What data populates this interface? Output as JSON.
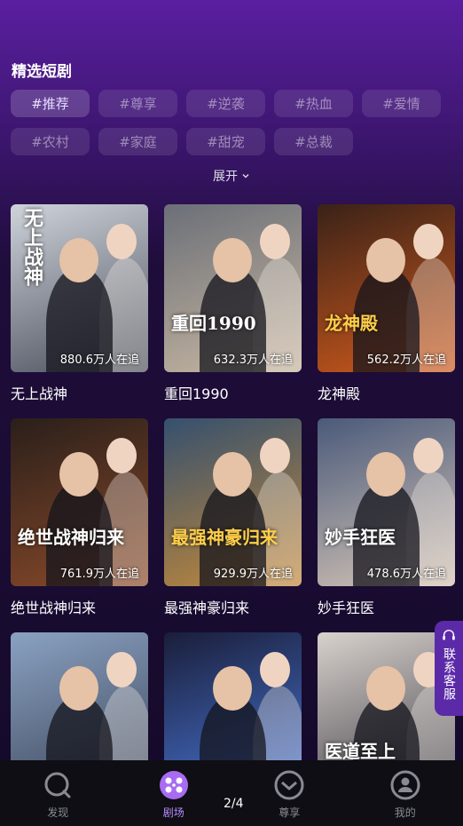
{
  "section": {
    "title": "精选短剧"
  },
  "tags": [
    "#推荐",
    "#尊享",
    "#逆袭",
    "#热血",
    "#爱情",
    "#农村",
    "#家庭",
    "#甜宠",
    "#总裁"
  ],
  "active_tag_index": 0,
  "expand_label": "展开",
  "dramas": [
    {
      "title": "无上战神",
      "watchers": "880.6万人在追",
      "poster_text": "无上战神",
      "colors": [
        "#cfd3da",
        "#4a4f5c"
      ]
    },
    {
      "title": "重回1990",
      "watchers": "632.3万人在追",
      "poster_text": "重回1990",
      "colors": [
        "#6b6f78",
        "#c9b8a2"
      ]
    },
    {
      "title": "龙神殿",
      "watchers": "562.2万人在追",
      "poster_text": "龙神殿",
      "colors": [
        "#3a2218",
        "#d05a1c"
      ]
    },
    {
      "title": "绝世战神归来",
      "watchers": "761.9万人在追",
      "poster_text": "绝世战神归来",
      "colors": [
        "#2a1f1a",
        "#8a4a2a"
      ]
    },
    {
      "title": "最强神豪归来",
      "watchers": "929.9万人在追",
      "poster_text": "最强神豪归来",
      "colors": [
        "#35506e",
        "#c48a3a"
      ]
    },
    {
      "title": "妙手狂医",
      "watchers": "478.6万人在追",
      "poster_text": "妙手狂医",
      "colors": [
        "#4a5a7a",
        "#d6c6b8"
      ]
    },
    {
      "title": "",
      "watchers": "",
      "poster_text": "",
      "colors": [
        "#8aa2c2",
        "#3a4256"
      ]
    },
    {
      "title": "",
      "watchers": "",
      "poster_text": "",
      "colors": [
        "#1a1e3a",
        "#4a78d8"
      ]
    },
    {
      "title": "",
      "watchers": "",
      "poster_text": "医道至上",
      "colors": [
        "#d8d2cc",
        "#3c3a44"
      ]
    }
  ],
  "contact_label": "联系客服",
  "pager": "2/4",
  "tabbar": {
    "items": [
      {
        "label": "发现",
        "icon": "discover-icon"
      },
      {
        "label": "剧场",
        "icon": "theater-icon"
      },
      {
        "label": "尊享",
        "icon": "premium-icon"
      },
      {
        "label": "我的",
        "icon": "profile-icon"
      }
    ],
    "active_index": 1,
    "accent": "#b98cff"
  }
}
